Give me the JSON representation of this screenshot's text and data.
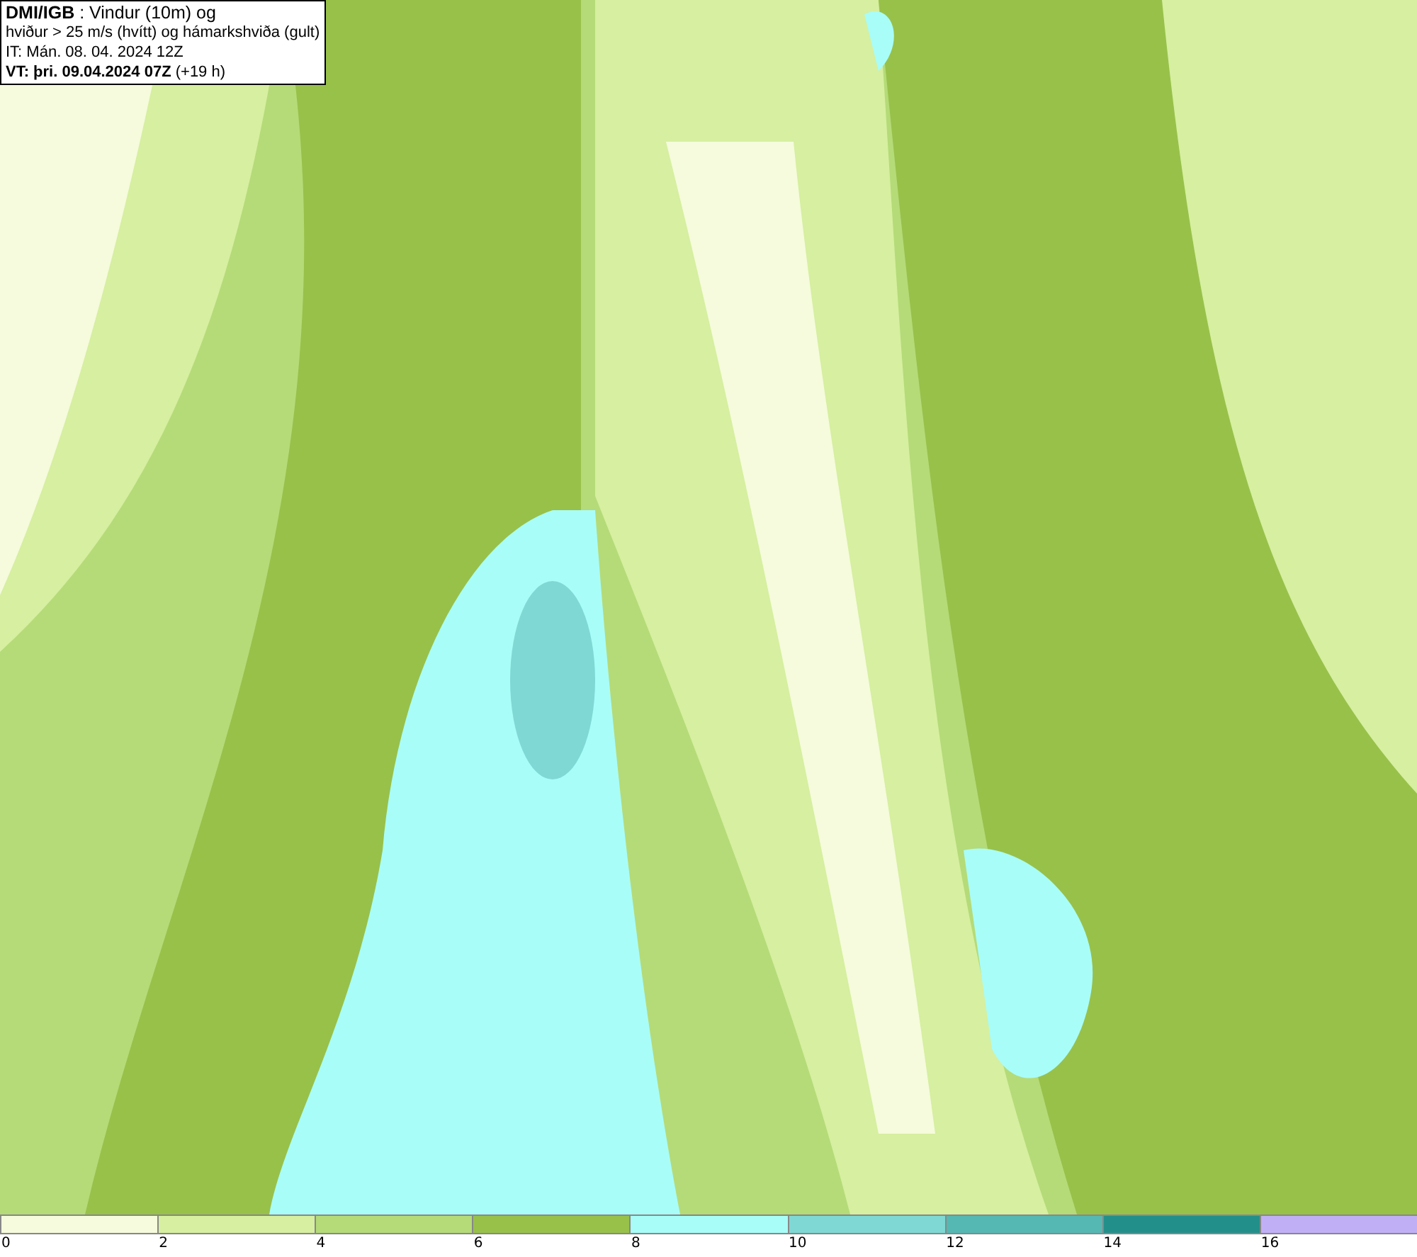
{
  "title_box": {
    "lines": [
      "**DMI/IGB** : Vindur (10m) og",
      "hviður > 25 m/s (hvítt) og hámarkshviða (gult)",
      "IT: Mán. 08. 04. 2024 12Z",
      "**VT: þri. 09.04.2024 07Z** (+19 h)"
    ]
  },
  "legend": {
    "bins": [
      {
        "label": "0",
        "color": "#f5fbdc"
      },
      {
        "label": "2",
        "color": "#d6efa0"
      },
      {
        "label": "4",
        "color": "#b5db78"
      },
      {
        "label": "6",
        "color": "#98c14a"
      },
      {
        "label": "8",
        "color": "#a8fdf8"
      },
      {
        "label": "10",
        "color": "#7fd8d4"
      },
      {
        "label": "12",
        "color": "#55b8b3"
      },
      {
        "label": "14",
        "color": "#238f8a"
      },
      {
        "label": "16",
        "color": "#c1aff6"
      }
    ]
  }
}
